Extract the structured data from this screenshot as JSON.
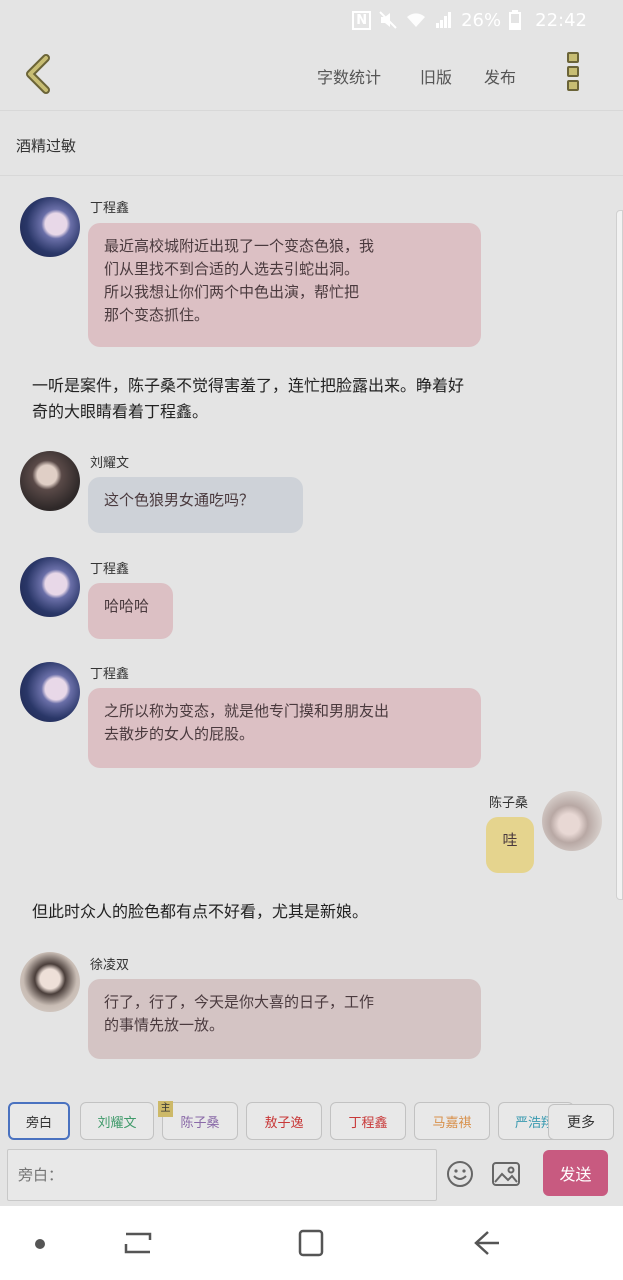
{
  "status_bar": {
    "battery": "26%",
    "time": "22:42",
    "nfc_icon": "N",
    "mute_icon": "mute-icon",
    "wifi_icon": "wifi-icon",
    "signal_icon": "signal-icon",
    "battery_icon": "battery-icon"
  },
  "toolbar": {
    "word_count": "字数统计",
    "old_version": "旧版",
    "publish": "发布"
  },
  "story": {
    "title": "酒精过敏"
  },
  "messages": [
    {
      "speaker": "丁程鑫",
      "lines": [
        "最近高校城附近出现了一个变态色狼，我",
        "们从里找不到合适的人选去引蛇出洞。",
        "所以我想让你们两个中色出演，帮忙把",
        "那个变态抓住。"
      ]
    },
    {
      "lines": [
        "一听是案件，陈子桑不觉得害羞了，连忙把脸露出来。睁着好",
        "奇的大眼睛看着丁程鑫。"
      ]
    },
    {
      "speaker": "刘耀文",
      "text": "这个色狼男女通吃吗？"
    },
    {
      "speaker": "丁程鑫",
      "text": "哈哈哈"
    },
    {
      "speaker": "丁程鑫",
      "lines": [
        "之所以称为变态，就是他专门摸和男朋友出",
        "去散步的女人的屁股。"
      ]
    },
    {
      "speaker": "陈子桑",
      "text": "哇"
    },
    {
      "text": "但此时众人的脸色都有点不好看，尤其是新娘。"
    },
    {
      "speaker": "徐凌双",
      "lines": [
        "行了，行了，今天是你大喜的日子，工作",
        "的事情先放一放。"
      ]
    }
  ],
  "chips": [
    {
      "label": "旁白",
      "color": "#333333"
    },
    {
      "label": "刘耀文",
      "color": "#3f9a6a"
    },
    {
      "label": "陈子桑",
      "color": "#8a6aa8"
    },
    {
      "label": "敖子逸",
      "color": "#c83838"
    },
    {
      "label": "丁程鑫",
      "color": "#c83838"
    },
    {
      "label": "马嘉祺",
      "color": "#d8904a"
    },
    {
      "label": "严浩翔",
      "color": "#3a9ab0"
    }
  ],
  "chip_badge": "主",
  "more_label": "更多",
  "input": {
    "placeholder": "旁白："
  },
  "send_label": "发送",
  "nav": {
    "recents": "recents-icon",
    "home": "home-icon",
    "back": "back-icon"
  }
}
